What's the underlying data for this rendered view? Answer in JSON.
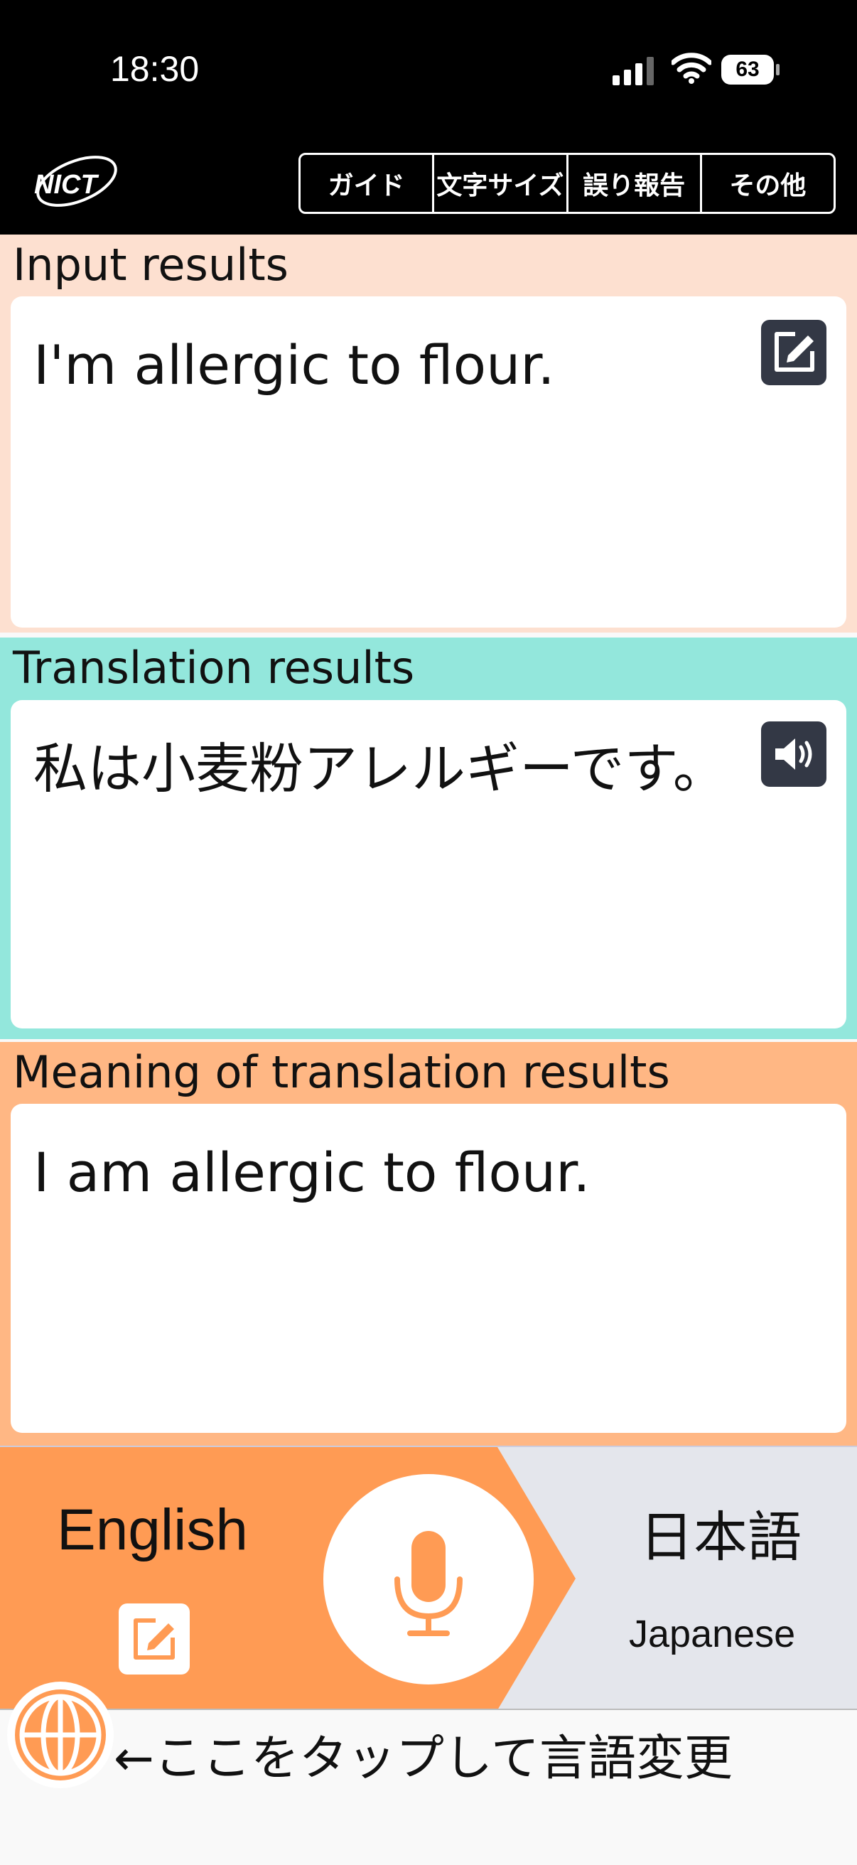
{
  "status_bar": {
    "time": "18:30",
    "battery": "63"
  },
  "header": {
    "logo_text": "NICT",
    "menu": [
      "ガイド",
      "文字サイズ",
      "誤り報告",
      "その他"
    ]
  },
  "input_panel": {
    "label": "Input results",
    "text": "I'm allergic to flour."
  },
  "translation_panel": {
    "label": "Translation results",
    "text": "私は小麦粉アレルギーです。"
  },
  "meaning_panel": {
    "label": "Meaning of translation results",
    "text": "I am allergic to flour."
  },
  "language_bar": {
    "source_language": "English",
    "target_language_native": "日本語",
    "target_language_english": "Japanese"
  },
  "hint": {
    "text": "←ここをタップして言語変更"
  },
  "colors": {
    "input_bg": "#fde0d0",
    "translation_bg": "#93e7dc",
    "meaning_bg": "#ffb784",
    "source_bg": "#ff9b54",
    "accent": "#ff9b54"
  },
  "icons": [
    "signal-icon",
    "wifi-icon",
    "battery-icon",
    "edit-icon",
    "speaker-icon",
    "microphone-icon",
    "globe-icon"
  ]
}
